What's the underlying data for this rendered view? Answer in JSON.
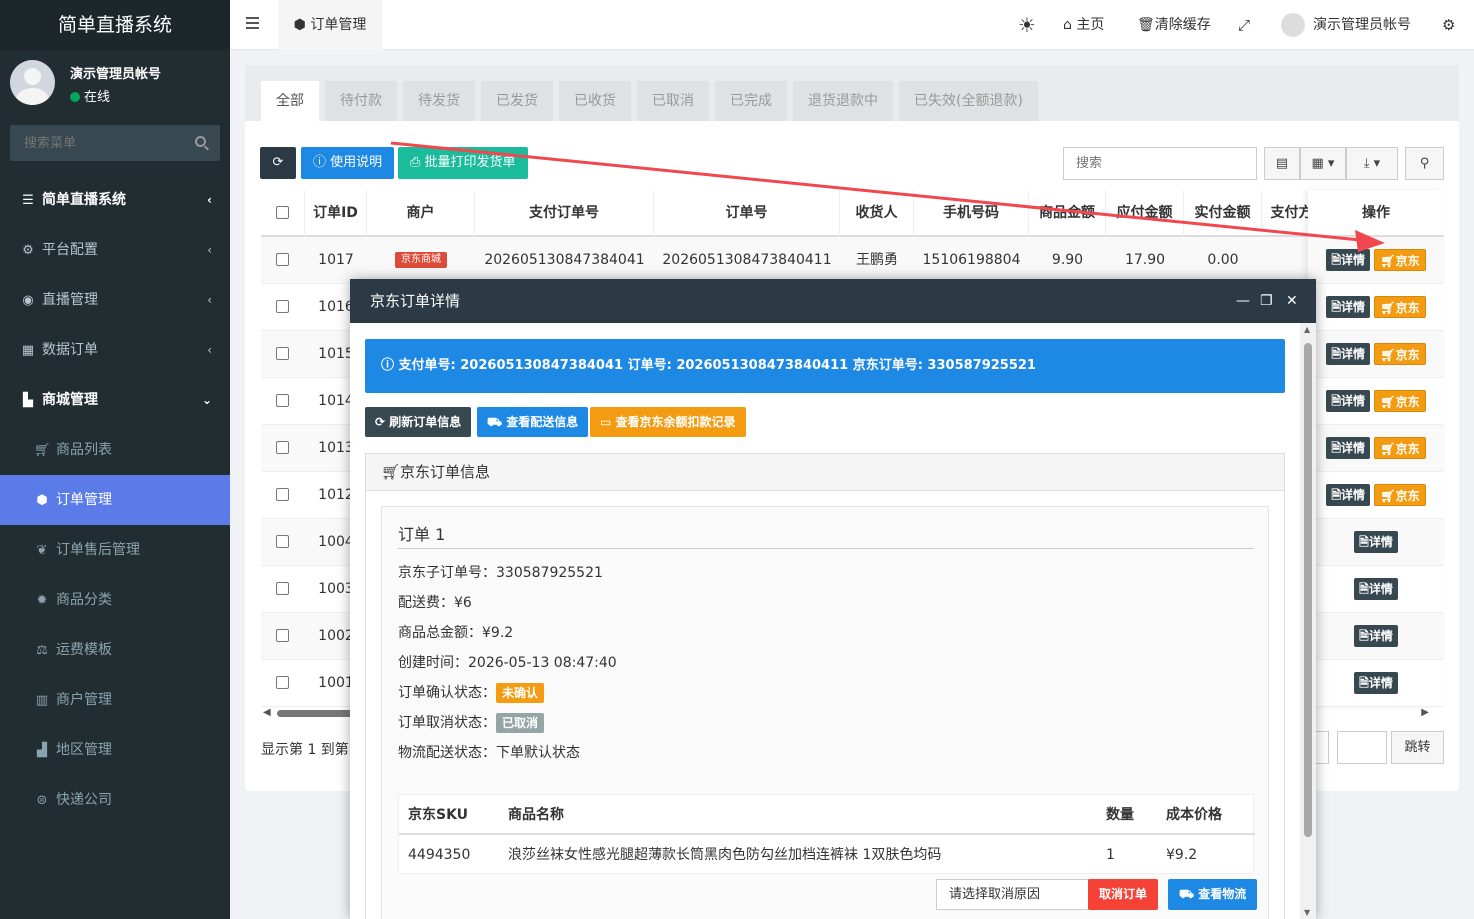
{
  "sidebar": {
    "brand": "简单直播系统",
    "user_name": "演示管理员帐号",
    "user_status": "在线",
    "search_placeholder": "搜索菜单",
    "items": [
      {
        "label": "简单直播系统",
        "icon": "list-icon",
        "level": "top"
      },
      {
        "label": "平台配置",
        "icon": "gear-icon",
        "level": "item"
      },
      {
        "label": "直播管理",
        "icon": "play-circle-icon",
        "level": "item"
      },
      {
        "label": "数据订单",
        "icon": "grid-icon",
        "level": "item"
      },
      {
        "label": "商城管理",
        "icon": "shopping-bag-icon",
        "level": "top-open"
      },
      {
        "label": "商品列表",
        "icon": "cart-icon",
        "level": "sub"
      },
      {
        "label": "订单管理",
        "icon": "cube-icon",
        "level": "sub-active"
      },
      {
        "label": "订单售后管理",
        "icon": "leaf-icon",
        "level": "sub"
      },
      {
        "label": "商品分类",
        "icon": "gear-icon",
        "level": "sub"
      },
      {
        "label": "运费模板",
        "icon": "steelyard-icon",
        "level": "sub"
      },
      {
        "label": "商户管理",
        "icon": "building-icon",
        "level": "sub"
      },
      {
        "label": "地区管理",
        "icon": "chart-area-icon",
        "level": "sub"
      },
      {
        "label": "快递公司",
        "icon": "yen-circle-icon",
        "level": "sub"
      }
    ]
  },
  "topbar": {
    "tab_label": "订单管理",
    "home_label": "主页",
    "clear_cache_label": "清除缓存",
    "user_label": "演示管理员帐号"
  },
  "status_tabs": [
    "全部",
    "待付款",
    "待发货",
    "已发货",
    "已收货",
    "已取消",
    "已完成",
    "退货退款中",
    "已失效(全额退款)"
  ],
  "toolbar": {
    "help_label": "使用说明",
    "batch_print_label": "批量打印发货单",
    "search_placeholder": "搜索"
  },
  "table": {
    "headers": [
      "订单ID",
      "商户",
      "支付订单号",
      "订单号",
      "收货人",
      "手机号码",
      "商品金额",
      "应付金额",
      "实付金额",
      "支付方",
      "操作"
    ],
    "first_row": {
      "id": "1017",
      "merchant": "京东商城",
      "pay_no": "202605130847384041",
      "order_no": "2026051308473840411",
      "receiver": "王鹏勇",
      "phone": "15106198804",
      "goods_amount": "9.90",
      "payable": "17.90",
      "paid": "0.00"
    },
    "ids": [
      "1017",
      "1016",
      "1015",
      "1014",
      "1013",
      "1012",
      "1004",
      "1003",
      "1002",
      "1001"
    ],
    "detail_label": "详情",
    "jd_label": "京东"
  },
  "footer": {
    "showing_text": "显示第 1 到第",
    "jump_label": "跳转"
  },
  "modal": {
    "title": "京东订单详情",
    "alert": "支付单号: 202605130847384041 订单号: 2026051308473840411 京东订单号: 330587925521",
    "refresh_label": "刷新订单信息",
    "delivery_label": "查看配送信息",
    "balance_label": "查看京东余额扣款记录",
    "panel_title": "京东订单信息",
    "order_title": "订单 1",
    "fields": [
      {
        "label": "京东子订单号：",
        "value": "330587925521"
      },
      {
        "label": "配送费：",
        "value": "¥6"
      },
      {
        "label": "商品总金额：",
        "value": "¥9.2"
      },
      {
        "label": "创建时间：",
        "value": "2026-05-13 08:47:40"
      }
    ],
    "confirm_label": "订单确认状态：",
    "confirm_value": "未确认",
    "cancel_state_label": "订单取消状态：",
    "cancel_state_value": "已取消",
    "logistics_label": "物流配送状态：",
    "logistics_value": "下单默认状态",
    "items_headers": [
      "京东SKU",
      "商品名称",
      "数量",
      "成本价格"
    ],
    "item": {
      "sku": "4494350",
      "name": "浪莎丝袜女性感光腿超薄款长筒黑肉色防勾丝加档连裤袜 1双肤色均码",
      "qty": "1",
      "price": "¥9.2"
    },
    "cancel_reason_placeholder": "请选择取消原因",
    "cancel_order_label": "取消订单",
    "logistics_button_label": "查看物流"
  },
  "colors": {
    "sidebar_bg": "#222d32",
    "active_item": "#5b7ce8",
    "primary": "#1e88e5",
    "success": "#1abc9c",
    "warning": "#f39c12",
    "danger": "#f44336",
    "dark": "#374850",
    "annotation_arrow": "#f0484e"
  }
}
